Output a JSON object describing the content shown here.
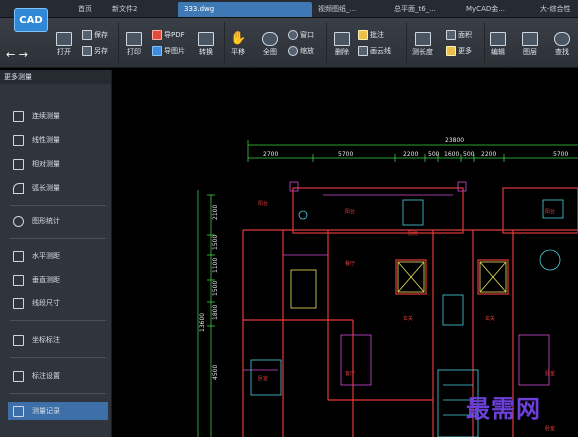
{
  "app": {
    "logo_text": "CAD"
  },
  "tabs": [
    "首页",
    "新文件2",
    "333.dwg",
    "视频图纸_...",
    "总平面_t6_...",
    "MyCAD金...",
    "大-综合性"
  ],
  "active_tab": "333.dwg",
  "ribbon": {
    "open": "打开",
    "save": "保存",
    "save_as": "另存",
    "print": "打印",
    "export_pdf": "导PDF",
    "export_image": "导图片",
    "convert": "转换",
    "pan": "平移",
    "full_view": "全图",
    "window": "窗口",
    "zoom": "缩放",
    "delete": "删除",
    "annotate": "批注",
    "cloud_line": "画云线",
    "measure_length": "测长度",
    "area": "面积",
    "more": "更多",
    "edit": "编辑",
    "layer": "图层",
    "search": "查找"
  },
  "panel": {
    "title": "更多测量",
    "items": [
      "连续测量",
      "线性测量",
      "相对测量",
      "弧长测量",
      "图形统计",
      "水平测距",
      "垂直测距",
      "线段尺寸",
      "坐标标注",
      "标注设置",
      "测量记录"
    ],
    "selected": "测量记录"
  },
  "drawing": {
    "top_dim": "23800",
    "dims_top": [
      "2700",
      "5700",
      "2200",
      "500",
      "1600",
      "500",
      "2200",
      "5700"
    ],
    "left_dims": [
      "2100",
      "1500",
      "1100",
      "1500",
      "1800",
      "4500"
    ],
    "left_total": "13600",
    "rooms": [
      "阳台",
      "阳台",
      "厨房",
      "餐厅",
      "客厅",
      "卧室",
      "卧室",
      "玄关",
      "玄关",
      "阳台",
      "卧室"
    ]
  },
  "watermark": "最需网"
}
